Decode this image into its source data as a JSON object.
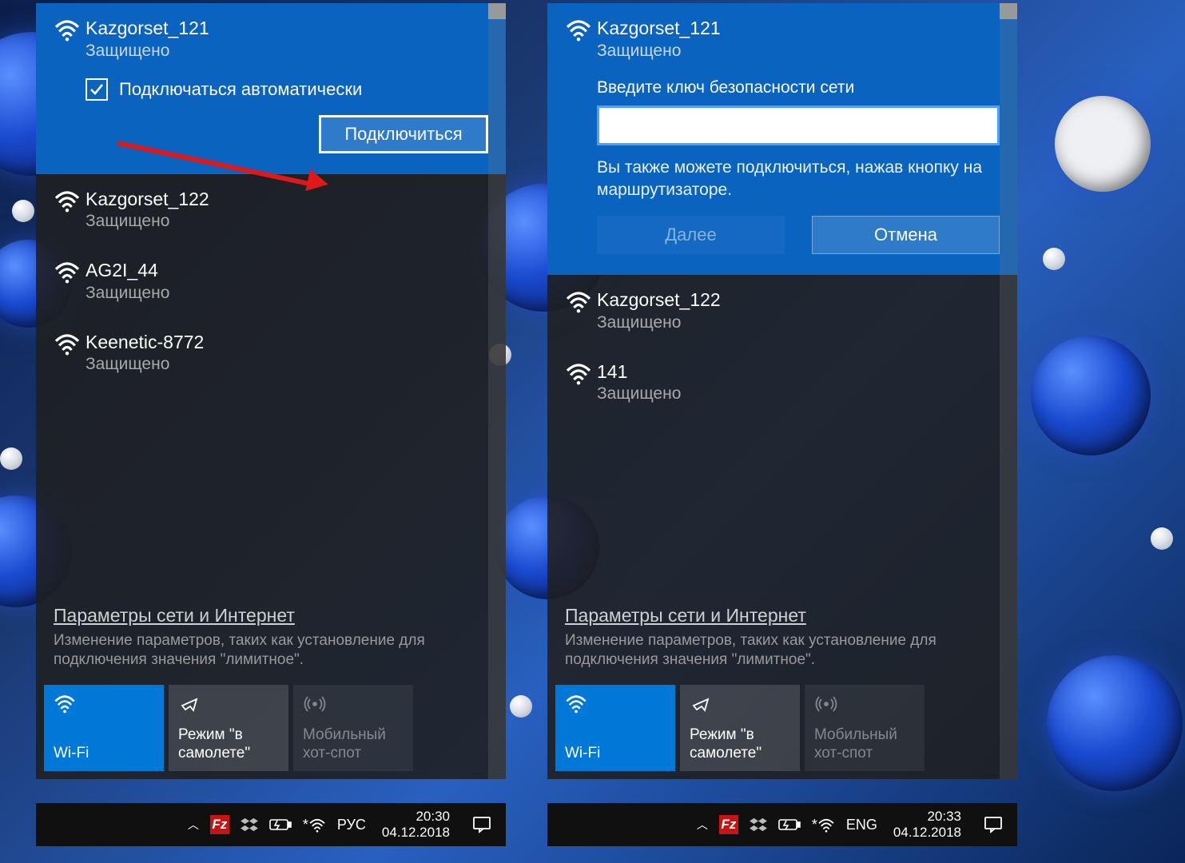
{
  "left": {
    "selected": {
      "ssid": "Kazgorset_121",
      "status": "Защищено",
      "auto_connect_label": "Подключаться автоматически",
      "connect_label": "Подключиться"
    },
    "networks": [
      {
        "ssid": "Kazgorset_122",
        "status": "Защищено"
      },
      {
        "ssid": "AG2I_44",
        "status": "Защищено"
      },
      {
        "ssid": "Keenetic-8772",
        "status": "Защищено"
      }
    ],
    "settings": {
      "title": "Параметры сети и Интернет",
      "desc": "Изменение параметров, таких как установление для подключения значения \"лимитное\"."
    },
    "tiles": {
      "wifi": "Wi-Fi",
      "airplane": "Режим \"в самолете\"",
      "hotspot": "Мобильный хот-спот"
    },
    "taskbar": {
      "lang": "РУС",
      "time": "20:30",
      "date": "04.12.2018"
    }
  },
  "right": {
    "selected": {
      "ssid": "Kazgorset_121",
      "status": "Защищено",
      "pw_label": "Введите ключ безопасности сети",
      "pw_value": "",
      "hint": "Вы также можете подключиться, нажав кнопку на маршрутизаторе.",
      "next_label": "Далее",
      "cancel_label": "Отмена"
    },
    "networks": [
      {
        "ssid": "Kazgorset_122",
        "status": "Защищено"
      },
      {
        "ssid": "141",
        "status": "Защищено"
      }
    ],
    "settings": {
      "title": "Параметры сети и Интернет",
      "desc": "Изменение параметров, таких как установление для подключения значения \"лимитное\"."
    },
    "tiles": {
      "wifi": "Wi-Fi",
      "airplane": "Режим \"в самолете\"",
      "hotspot": "Мобильный хот-спот"
    },
    "taskbar": {
      "lang": "ENG",
      "time": "20:33",
      "date": "04.12.2018"
    }
  }
}
